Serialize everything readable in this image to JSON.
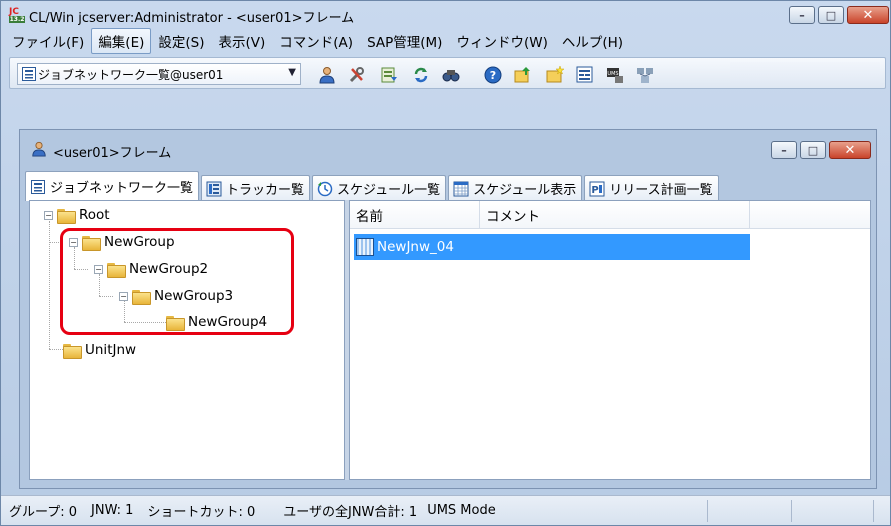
{
  "window": {
    "title": "CL/Win jcserver:Administrator - <user01>フレーム",
    "icon_text_top": "JC",
    "icon_text_bottom": "13.2"
  },
  "menubar": {
    "items": [
      {
        "label": "ファイル(F)"
      },
      {
        "label": "編集(E)"
      },
      {
        "label": "設定(S)"
      },
      {
        "label": "表示(V)"
      },
      {
        "label": "コマンド(A)"
      },
      {
        "label": "SAP管理(M)"
      },
      {
        "label": "ウィンドウ(W)"
      },
      {
        "label": "ヘルプ(H)"
      }
    ]
  },
  "toolbar": {
    "combo_value": "ジョブネットワーク一覧@user01",
    "icons": [
      "user-icon",
      "tools-icon",
      "export-icon",
      "refresh-icon",
      "find-icon",
      "help-icon",
      "folder-up-icon",
      "new-folder-icon",
      "list-icon",
      "ums-icon",
      "network-icon"
    ]
  },
  "frame": {
    "title": "<user01>フレーム"
  },
  "tabs": [
    {
      "label": "ジョブネットワーク一覧",
      "icon": "jobnet-list-icon",
      "active": true
    },
    {
      "label": "トラッカー覧",
      "icon": "tracker-icon",
      "active": false
    },
    {
      "label": "スケジュール一覧",
      "icon": "schedule-icon",
      "active": false
    },
    {
      "label": "スケジュール表示",
      "icon": "calendar-icon",
      "active": false
    },
    {
      "label": "リリース計画一覧",
      "icon": "release-icon",
      "active": false
    }
  ],
  "tree": {
    "nodes": [
      {
        "label": "Root"
      },
      {
        "label": "NewGroup"
      },
      {
        "label": "NewGroup2"
      },
      {
        "label": "NewGroup3"
      },
      {
        "label": "NewGroup4"
      },
      {
        "label": "UnitJnw"
      }
    ]
  },
  "list": {
    "columns": [
      "名前",
      "コメント"
    ],
    "rows": [
      {
        "name": "NewJnw_04",
        "comment": ""
      }
    ]
  },
  "status": {
    "group": "グループ: 0",
    "jnw": "JNW: 1",
    "shortcut": "ショートカット: 0",
    "total": "ユーザの全JNW合計: 1",
    "mode": "UMS Mode"
  },
  "colors": {
    "highlight": "#e60012",
    "selection": "#3399ff"
  }
}
